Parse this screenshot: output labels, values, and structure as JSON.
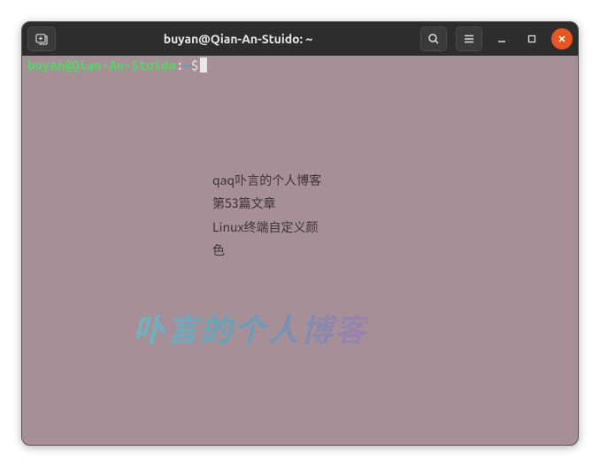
{
  "window": {
    "title": "buyan@Qian-An-Stuido: ~"
  },
  "prompt": {
    "user_host": "buyan@Qian-An-Stuido",
    "separator": ":",
    "path": "~",
    "symbol": "$"
  },
  "watermark": {
    "line1": "qaq卟言的个人博客",
    "line2": "第53篇文章",
    "line3": "Linux终端自定义颜",
    "line4": "色",
    "large": "卟言的个人博客"
  },
  "icons": {
    "new_tab": "new-tab-icon",
    "search": "search-icon",
    "menu": "hamburger-icon",
    "minimize": "minimize-icon",
    "maximize": "maximize-icon",
    "close": "close-icon"
  }
}
